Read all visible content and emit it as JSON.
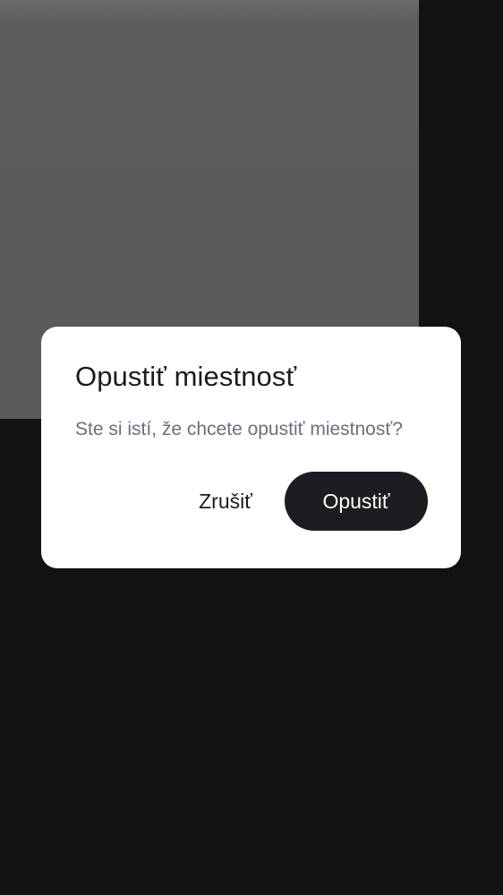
{
  "dialog": {
    "title": "Opustiť miestnosť",
    "message": "Ste si istí, že chcete opustiť miestnosť?",
    "cancel_label": "Zrušiť",
    "confirm_label": "Opustiť"
  },
  "colors": {
    "background": "#121212",
    "backdrop_panel": "#5a5a5a",
    "dialog_surface": "#ffffff",
    "primary_button": "#1c1d21",
    "title_text": "#1b1c20",
    "message_text": "#6b6f78"
  }
}
